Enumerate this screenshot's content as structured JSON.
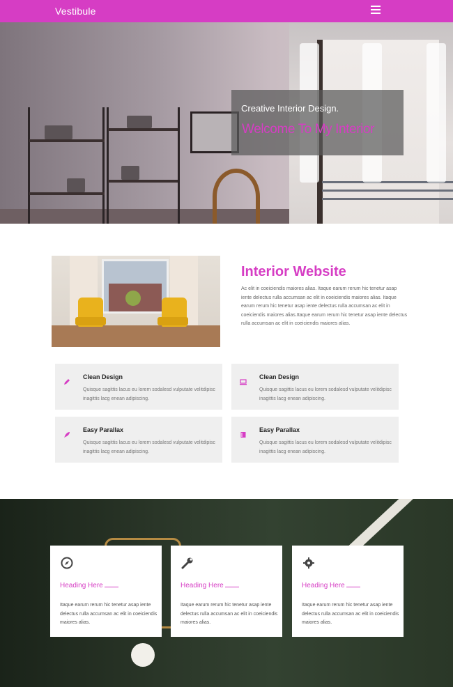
{
  "header": {
    "brand": "Vestibule",
    "menu_icon": "hamburger-menu-icon"
  },
  "hero": {
    "subtitle": "Creative Interior Design.",
    "title": "Welcome To My Interior"
  },
  "about": {
    "title": "Interior Website",
    "text": "Ac elit in coeiciendis maiores alias. Itaque earum rerum hic tenetur asap iente delectus rulla accumsan ac elit in coeiciendis maiores alias. Itaque earum rerum hic tenetur asap iente delectus rulla accumsan ac elit in coeiciendis maiores alias.Itaque earum rerum hic tenetur asap iente delectus rulla accumsan ac elit in coeiciendis maiores alias."
  },
  "features": [
    {
      "title": "Clean Design",
      "icon": "pencil-icon",
      "text": "Quisque sagittis lacus eu lorem sodalesd vulputate velitdipisc inagittis lacg enean adipiscing."
    },
    {
      "title": "Clean Design",
      "icon": "laptop-icon",
      "text": "Quisque sagittis lacus eu lorem sodalesd vulputate velitdipisc inagittis lacg enean adipiscing."
    },
    {
      "title": "Easy Parallax",
      "icon": "rocket-icon",
      "text": "Quisque sagittis lacus eu lorem sodalesd vulputate velitdipisc inagittis lacg enean adipiscing."
    },
    {
      "title": "Easy Parallax",
      "icon": "book-icon",
      "text": "Quisque sagittis lacus eu lorem sodalesd vulputate velitdipisc inagittis lacg enean adipiscing."
    }
  ],
  "cards": [
    {
      "title": "Heading Here",
      "icon": "compass-icon",
      "text": "Itaque earum rerum hic tenetur asap iente delectus rulla accumsan ac elit in coeiciendis maiores alias."
    },
    {
      "title": "Heading Here",
      "icon": "wrench-icon",
      "text": "Itaque earum rerum hic tenetur asap iente delectus rulla accumsan ac elit in coeiciendis maiores alias."
    },
    {
      "title": "Heading Here",
      "icon": "gear-icon",
      "text": "Itaque earum rerum hic tenetur asap iente delectus rulla accumsan ac elit in coeiciendis maiores alias."
    }
  ],
  "colors": {
    "accent": "#d63dc4",
    "feature_bg": "#efefef",
    "dark_section": "#2a3628"
  }
}
